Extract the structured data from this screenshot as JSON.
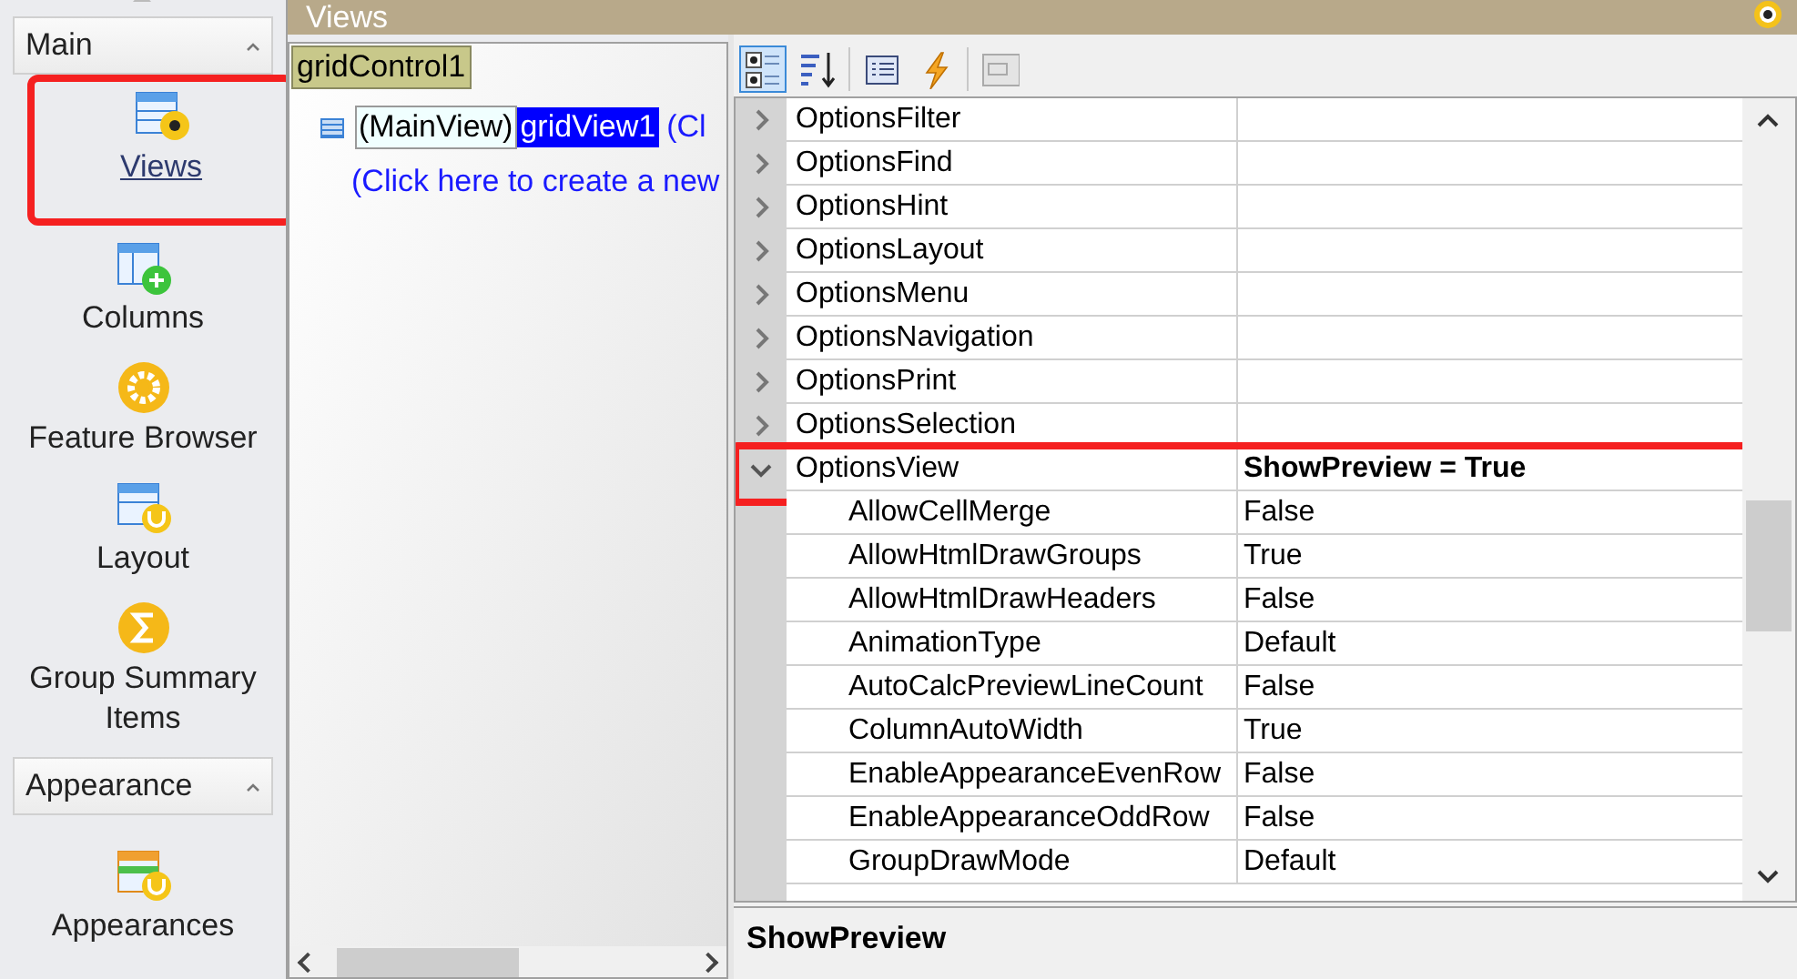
{
  "title_bar": {
    "title": "Views"
  },
  "sidebar": {
    "groups": [
      {
        "label": "Main",
        "expanded": true,
        "items": [
          {
            "label": "Views",
            "selected": true,
            "highlighted": true
          },
          {
            "label": "Columns",
            "selected": false,
            "highlighted": false
          },
          {
            "label": "Feature Browser",
            "selected": false,
            "highlighted": false
          },
          {
            "label": "Layout",
            "selected": false,
            "highlighted": false
          },
          {
            "label": "Group Summary Items",
            "selected": false,
            "highlighted": false
          }
        ]
      },
      {
        "label": "Appearance",
        "expanded": true,
        "items": [
          {
            "label": "Appearances",
            "selected": false,
            "highlighted": false
          }
        ]
      }
    ]
  },
  "tree": {
    "root": "gridControl1",
    "view_tag": "(MainView)",
    "view_name": "gridView1",
    "view_link": "(Cl",
    "create_link": "(Click here to create a new"
  },
  "property_grid": {
    "toolbar": [
      {
        "kind": "categorized",
        "selected": true
      },
      {
        "kind": "alphabetical",
        "selected": false
      },
      {
        "kind": "properties",
        "selected": false
      },
      {
        "kind": "events",
        "selected": false
      },
      {
        "kind": "pages",
        "selected": false
      }
    ],
    "rows": [
      {
        "name": "OptionsFilter",
        "expanded": false,
        "highlighted": false
      },
      {
        "name": "OptionsFind",
        "expanded": false,
        "highlighted": false
      },
      {
        "name": "OptionsHint",
        "expanded": false,
        "highlighted": false
      },
      {
        "name": "OptionsLayout",
        "expanded": false,
        "highlighted": false
      },
      {
        "name": "OptionsMenu",
        "expanded": false,
        "highlighted": false
      },
      {
        "name": "OptionsNavigation",
        "expanded": false,
        "highlighted": false
      },
      {
        "name": "OptionsPrint",
        "expanded": false,
        "highlighted": false
      },
      {
        "name": "OptionsSelection",
        "expanded": false,
        "highlighted": false
      },
      {
        "name": "OptionsView",
        "value": "ShowPreview = True",
        "expanded": true,
        "highlighted": true,
        "children": [
          {
            "name": "AllowCellMerge",
            "value": "False"
          },
          {
            "name": "AllowHtmlDrawGroups",
            "value": "True"
          },
          {
            "name": "AllowHtmlDrawHeaders",
            "value": "False"
          },
          {
            "name": "AnimationType",
            "value": "Default"
          },
          {
            "name": "AutoCalcPreviewLineCount",
            "value": "False"
          },
          {
            "name": "ColumnAutoWidth",
            "value": "True"
          },
          {
            "name": "EnableAppearanceEvenRow",
            "value": "False"
          },
          {
            "name": "EnableAppearanceOddRow",
            "value": "False"
          },
          {
            "name": "GroupDrawMode",
            "value": "Default"
          }
        ]
      }
    ]
  },
  "description": {
    "title": "ShowPreview"
  }
}
